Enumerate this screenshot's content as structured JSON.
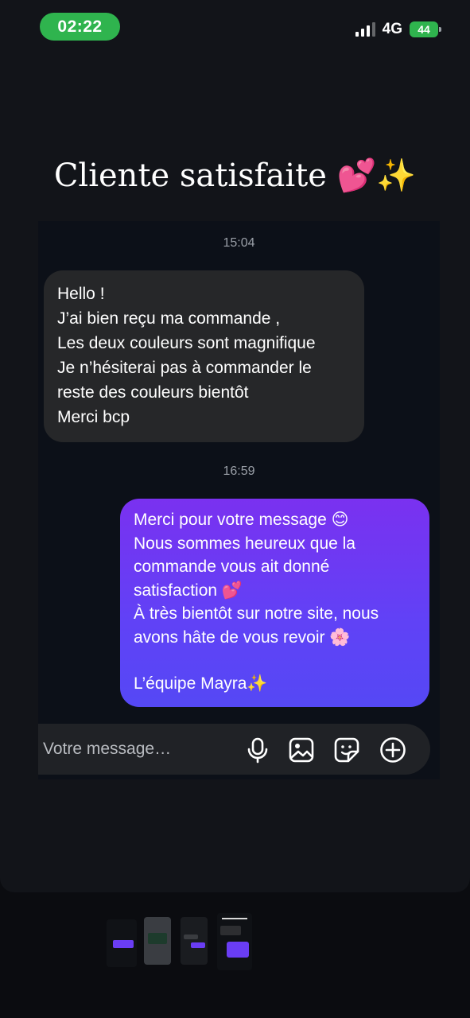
{
  "status_bar": {
    "time": "02:22",
    "network": "4G",
    "battery": "44"
  },
  "story": {
    "title": "Cliente satisfaite 💕✨"
  },
  "chat": {
    "timestamp_1": "15:04",
    "incoming": {
      "lines": [
        "Hello !",
        "J’ai bien reçu ma commande ,",
        "Les deux couleurs sont magnifique",
        "Je n’hésiterai pas à commander le",
        "reste des couleurs bientôt",
        "Merci bcp"
      ]
    },
    "timestamp_2": "16:59",
    "outgoing": {
      "lines": [
        "Merci pour votre message 😊",
        "Nous sommes heureux que la",
        "commande vous ait donné",
        "satisfaction 💕",
        "À très bientôt sur notre site, nous",
        "avons hâte de vous revoir 🌸",
        "",
        "L’équipe Mayra✨"
      ]
    },
    "input": {
      "placeholder": "Votre message…"
    }
  },
  "icons": [
    "microphone-icon",
    "image-icon",
    "sticker-icon",
    "plus-circle-icon"
  ],
  "colors": {
    "status_green": "#2fb44e",
    "outgoing_bubble": "#6a3df4",
    "incoming_bubble": "#262729",
    "background": "#121419"
  }
}
